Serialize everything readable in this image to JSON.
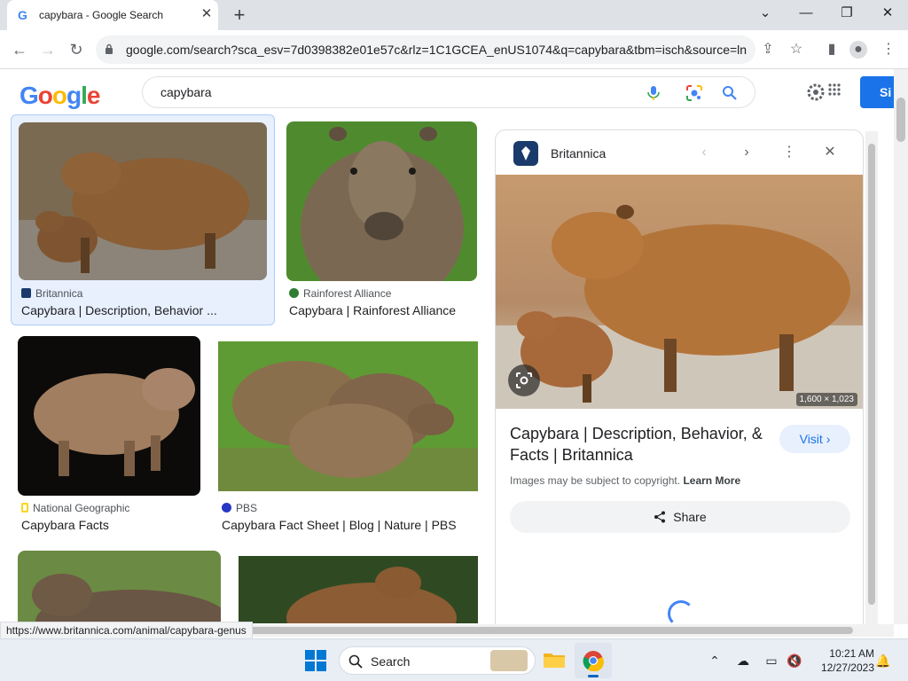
{
  "browser": {
    "tab_title": "capybara - Google Search",
    "tab_favicon": "G",
    "url": "google.com/search?sca_esv=7d0398382e01e57c&rlz=1C1GCEA_enUS1074&q=capybara&tbm=isch&source=ln..."
  },
  "google": {
    "logo_text": "Google",
    "query": "capybara",
    "signin_label": "Si"
  },
  "results": [
    {
      "source": "Britannica",
      "caption": "Capybara | Description, Behavior ...",
      "source_color": "#1a3a6b"
    },
    {
      "source": "Rainforest Alliance",
      "caption": "Capybara | Rainforest Alliance",
      "source_color": "#2e7d32"
    },
    {
      "source": "National Geographic",
      "caption": "Capybara Facts",
      "source_color": "#f9d71c"
    },
    {
      "source": "PBS",
      "caption": "Capybara Fact Sheet | Blog | Nature | PBS",
      "source_color": "#2638c4"
    }
  ],
  "panel": {
    "source": "Britannica",
    "title": "Capybara | Description, Behavior, & Facts | Britannica",
    "dimensions": "1,600 × 1,023",
    "visit_label": "Visit",
    "copyright_text": "Images may be subject to copyright.",
    "learn_more": "Learn More",
    "share_label": "Share"
  },
  "status_url": "https://www.britannica.com/animal/capybara-genus",
  "taskbar": {
    "search_label": "Search",
    "time": "10:21 AM",
    "date": "12/27/2023"
  },
  "colors": {
    "accent": "#1a73e8",
    "selected_bg": "#e8f0fe",
    "selected_border": "#aecbfa"
  }
}
